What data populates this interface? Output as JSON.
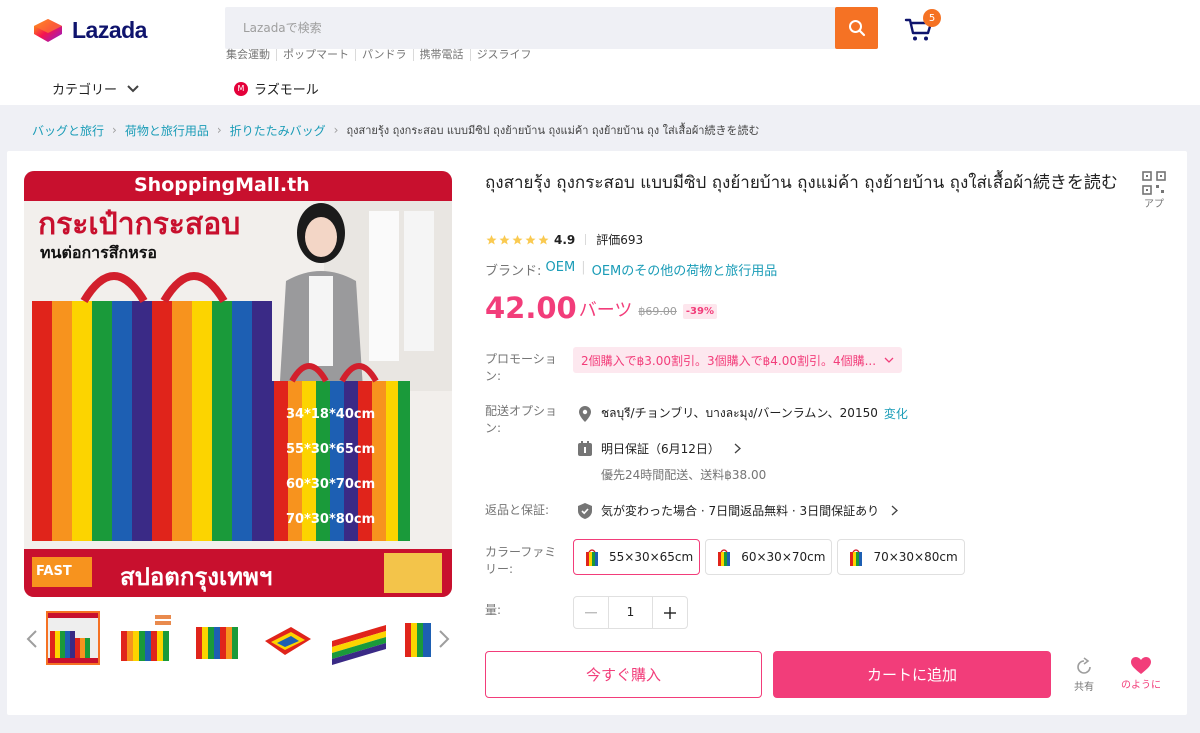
{
  "header": {
    "logo_text": "Lazada",
    "search_placeholder": "Lazadaで検索",
    "cart_count": "5",
    "hot_links": [
      "集会運動",
      "ポップマート",
      "パンドラ",
      "携帯電話",
      "ジスライフ"
    ],
    "category_label": "カテゴリー",
    "lazmall_label": "ラズモール"
  },
  "breadcrumb": {
    "items": [
      "バッグと旅行",
      "荷物と旅行用品",
      "折りたたみバッグ"
    ],
    "current": "ถุงสายรุ้ง ถุงกระสอบ แบบมีซิป ถุงย้ายบ้าน ถุงแม่ค้า ถุงย้ายบ้าน ถุง ใส่เสื้อผ้า続きを読む"
  },
  "gallery": {
    "store_banner": "ShoppingMall.th",
    "headline": "กระเป๋ากระสอบ",
    "subheadline": "ทนต่อการสึกหรอ",
    "sizes": [
      "34*18*40cm",
      "55*30*65cm",
      "60*30*70cm",
      "70*30*80cm"
    ],
    "fast_label": "FAST",
    "bottom_banner": "สปอตกรุงเทพฯ"
  },
  "product": {
    "title": "ถุงสายรุ้ง ถุงกระสอบ แบบมีซิป ถุงย้ายบ้าน ถุงแม่ค้า ถุงย้ายบ้าน ถุงใส่เสื้อผ้า続きを読む",
    "qr_label": "アプ",
    "rating": "4.9",
    "rating_stars": 5,
    "reviews": "評価693",
    "brand_label": "ブランド:",
    "brand": "OEM",
    "brand_more": "OEMのその他の荷物と旅行用品",
    "price": "42.00",
    "price_unit": "バーツ",
    "original_price": "฿69.00",
    "discount": "-39%",
    "promo_label": "プロモーション:",
    "promo_text": "2個購入で฿3.00割引。3個購入で฿4.00割引。4個購...",
    "shipping_label": "配送オプション:",
    "location": "ชลบุรี/チョンブリ、บางละมุง/バーンラムン、20150",
    "change_link": "変化",
    "delivery": "明日保証（6月12日）",
    "delivery_sub": "優先24時間配送、送料฿38.00",
    "returns_label": "返品と保証:",
    "returns_text": "気が変わった場合 · 7日間返品無料 · 3日間保証あり",
    "variant_label": "カラーファミリー:",
    "variants": [
      "55×30×65cm",
      "60×30×70cm",
      "70×30×80cm"
    ],
    "qty_label": "量:",
    "qty": "1",
    "buy_now": "今すぐ購入",
    "add_to_cart": "カートに追加",
    "share": "共有",
    "like": "のように"
  },
  "colors": {
    "accent": "#f23d7a",
    "orange": "#f57224",
    "link": "#1a9cb7"
  }
}
